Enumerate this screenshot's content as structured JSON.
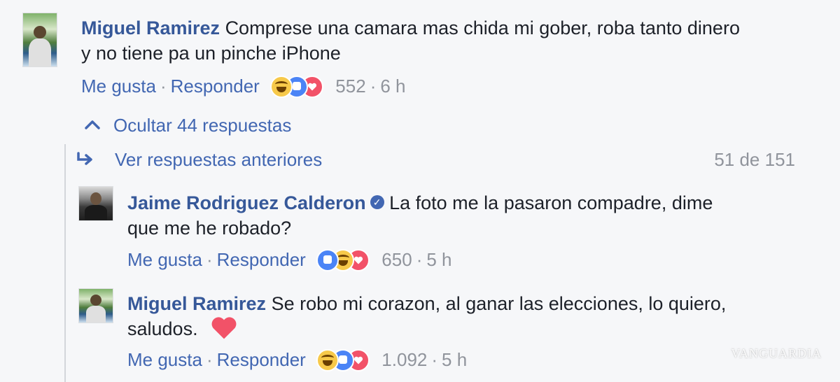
{
  "comments": {
    "top": {
      "author": "Miguel Ramirez",
      "text_line1": "Comprese una camara mas chida mi gober, roba tanto dinero",
      "text_line2": "y no tiene pa un pinche iPhone",
      "like_label": "Me gusta",
      "reply_label": "Responder",
      "reaction_count": "552",
      "time": "6 h",
      "reactions": [
        "haha-icon",
        "like-icon",
        "love-icon"
      ]
    },
    "replies_toggle": {
      "label": "Ocultar 44 respuestas"
    },
    "previous": {
      "label": "Ver respuestas anteriores",
      "counter": "51 de 151"
    },
    "reply1": {
      "author": "Jaime Rodriguez Calderon",
      "text_line1": "La foto me la pasaron compadre, dime",
      "text_line2": "que me he robado?",
      "like_label": "Me gusta",
      "reply_label": "Responder",
      "reaction_count": "650",
      "time": "5 h",
      "verified": true,
      "reactions": [
        "like-icon",
        "haha-icon",
        "love-icon"
      ]
    },
    "reply2": {
      "author": "Miguel Ramirez",
      "text_line1": "Se robo mi corazon, al ganar las elecciones, lo quiero,",
      "text_line2": "saludos.",
      "like_label": "Me gusta",
      "reply_label": "Responder",
      "reaction_count": "1.092",
      "time": "5 h",
      "reactions": [
        "haha-icon",
        "like-icon",
        "love-icon"
      ]
    }
  },
  "watermark": "VANGUARDIA",
  "colors": {
    "name": "#365899",
    "link": "#4267b2",
    "meta": "#90949c",
    "background": "#f6f7f9",
    "heart": "#f25268"
  }
}
